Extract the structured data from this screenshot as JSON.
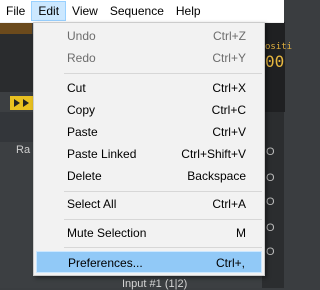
{
  "menubar": {
    "items": [
      {
        "label": "File"
      },
      {
        "label": "Edit"
      },
      {
        "label": "View"
      },
      {
        "label": "Sequence"
      },
      {
        "label": "Help"
      }
    ]
  },
  "edit_menu": {
    "undo": {
      "label": "Undo",
      "shortcut": "Ctrl+Z"
    },
    "redo": {
      "label": "Redo",
      "shortcut": "Ctrl+Y"
    },
    "cut": {
      "label": "Cut",
      "shortcut": "Ctrl+X"
    },
    "copy": {
      "label": "Copy",
      "shortcut": "Ctrl+C"
    },
    "paste": {
      "label": "Paste",
      "shortcut": "Ctrl+V"
    },
    "paste_linked": {
      "label": "Paste Linked",
      "shortcut": "Ctrl+Shift+V"
    },
    "delete": {
      "label": "Delete",
      "shortcut": "Backspace"
    },
    "select_all": {
      "label": "Select All",
      "shortcut": "Ctrl+A"
    },
    "mute_selection": {
      "label": "Mute Selection",
      "shortcut": "M"
    },
    "preferences": {
      "label": "Preferences...",
      "shortcut": "Ctrl+,"
    }
  },
  "background": {
    "side_label": "Ra",
    "bottom_label": "Input #1 (1|2)",
    "right_labels": [
      "ositi",
      "00",
      "O",
      "O",
      "O",
      "O",
      "O"
    ]
  }
}
